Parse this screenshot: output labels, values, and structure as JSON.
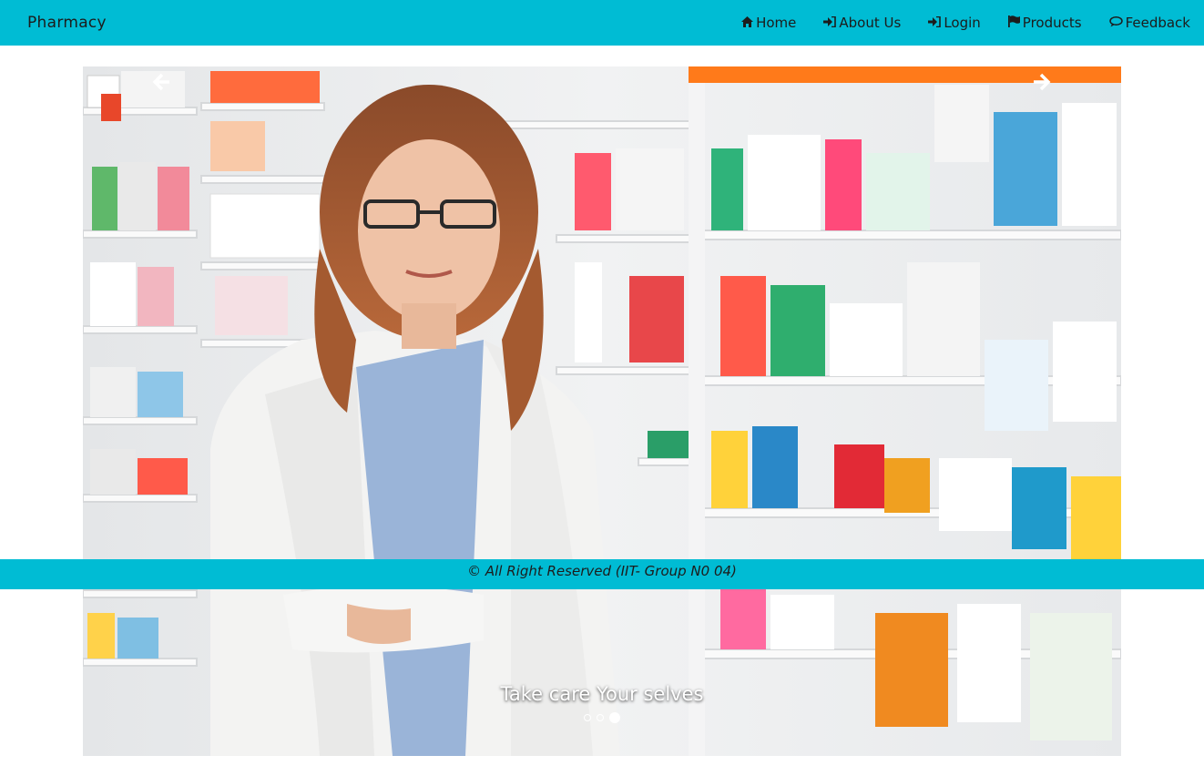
{
  "brand": "Pharmacy",
  "nav": [
    {
      "label": "Home",
      "icon": "home-icon"
    },
    {
      "label": "About Us",
      "icon": "login-icon"
    },
    {
      "label": "Login",
      "icon": "login-icon"
    },
    {
      "label": "Products",
      "icon": "flag-icon"
    },
    {
      "label": "Feedback",
      "icon": "comment-icon"
    }
  ],
  "carousel": {
    "caption": "Take care Your selves",
    "slide_count": 3,
    "active_slide": 3
  },
  "footer": "© All Right Reserved (IIT- Group N0 04)",
  "colors": {
    "accent": "#00bcd4",
    "text": "#1c1c1c"
  }
}
